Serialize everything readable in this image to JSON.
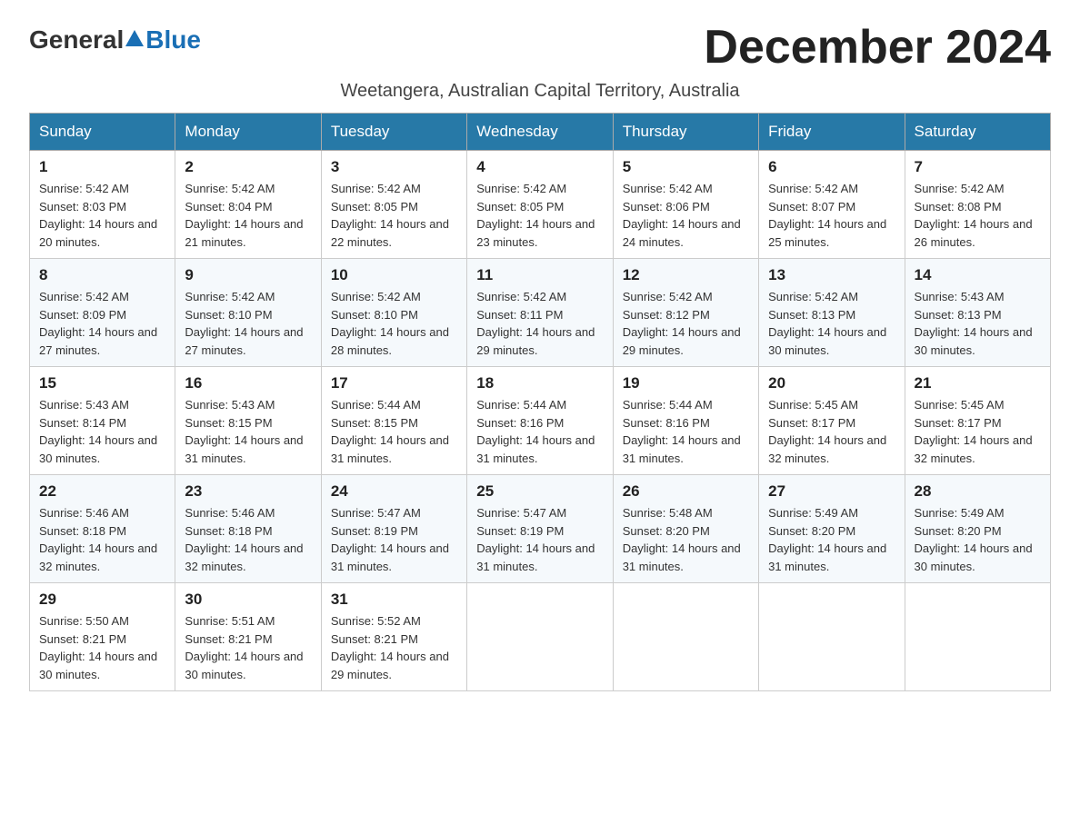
{
  "logo": {
    "general": "General",
    "blue": "Blue"
  },
  "header": {
    "month_year": "December 2024",
    "location": "Weetangera, Australian Capital Territory, Australia"
  },
  "columns": [
    "Sunday",
    "Monday",
    "Tuesday",
    "Wednesday",
    "Thursday",
    "Friday",
    "Saturday"
  ],
  "weeks": [
    [
      {
        "day": "1",
        "sunrise": "5:42 AM",
        "sunset": "8:03 PM",
        "daylight": "14 hours and 20 minutes."
      },
      {
        "day": "2",
        "sunrise": "5:42 AM",
        "sunset": "8:04 PM",
        "daylight": "14 hours and 21 minutes."
      },
      {
        "day": "3",
        "sunrise": "5:42 AM",
        "sunset": "8:05 PM",
        "daylight": "14 hours and 22 minutes."
      },
      {
        "day": "4",
        "sunrise": "5:42 AM",
        "sunset": "8:05 PM",
        "daylight": "14 hours and 23 minutes."
      },
      {
        "day": "5",
        "sunrise": "5:42 AM",
        "sunset": "8:06 PM",
        "daylight": "14 hours and 24 minutes."
      },
      {
        "day": "6",
        "sunrise": "5:42 AM",
        "sunset": "8:07 PM",
        "daylight": "14 hours and 25 minutes."
      },
      {
        "day": "7",
        "sunrise": "5:42 AM",
        "sunset": "8:08 PM",
        "daylight": "14 hours and 26 minutes."
      }
    ],
    [
      {
        "day": "8",
        "sunrise": "5:42 AM",
        "sunset": "8:09 PM",
        "daylight": "14 hours and 27 minutes."
      },
      {
        "day": "9",
        "sunrise": "5:42 AM",
        "sunset": "8:10 PM",
        "daylight": "14 hours and 27 minutes."
      },
      {
        "day": "10",
        "sunrise": "5:42 AM",
        "sunset": "8:10 PM",
        "daylight": "14 hours and 28 minutes."
      },
      {
        "day": "11",
        "sunrise": "5:42 AM",
        "sunset": "8:11 PM",
        "daylight": "14 hours and 29 minutes."
      },
      {
        "day": "12",
        "sunrise": "5:42 AM",
        "sunset": "8:12 PM",
        "daylight": "14 hours and 29 minutes."
      },
      {
        "day": "13",
        "sunrise": "5:42 AM",
        "sunset": "8:13 PM",
        "daylight": "14 hours and 30 minutes."
      },
      {
        "day": "14",
        "sunrise": "5:43 AM",
        "sunset": "8:13 PM",
        "daylight": "14 hours and 30 minutes."
      }
    ],
    [
      {
        "day": "15",
        "sunrise": "5:43 AM",
        "sunset": "8:14 PM",
        "daylight": "14 hours and 30 minutes."
      },
      {
        "day": "16",
        "sunrise": "5:43 AM",
        "sunset": "8:15 PM",
        "daylight": "14 hours and 31 minutes."
      },
      {
        "day": "17",
        "sunrise": "5:44 AM",
        "sunset": "8:15 PM",
        "daylight": "14 hours and 31 minutes."
      },
      {
        "day": "18",
        "sunrise": "5:44 AM",
        "sunset": "8:16 PM",
        "daylight": "14 hours and 31 minutes."
      },
      {
        "day": "19",
        "sunrise": "5:44 AM",
        "sunset": "8:16 PM",
        "daylight": "14 hours and 31 minutes."
      },
      {
        "day": "20",
        "sunrise": "5:45 AM",
        "sunset": "8:17 PM",
        "daylight": "14 hours and 32 minutes."
      },
      {
        "day": "21",
        "sunrise": "5:45 AM",
        "sunset": "8:17 PM",
        "daylight": "14 hours and 32 minutes."
      }
    ],
    [
      {
        "day": "22",
        "sunrise": "5:46 AM",
        "sunset": "8:18 PM",
        "daylight": "14 hours and 32 minutes."
      },
      {
        "day": "23",
        "sunrise": "5:46 AM",
        "sunset": "8:18 PM",
        "daylight": "14 hours and 32 minutes."
      },
      {
        "day": "24",
        "sunrise": "5:47 AM",
        "sunset": "8:19 PM",
        "daylight": "14 hours and 31 minutes."
      },
      {
        "day": "25",
        "sunrise": "5:47 AM",
        "sunset": "8:19 PM",
        "daylight": "14 hours and 31 minutes."
      },
      {
        "day": "26",
        "sunrise": "5:48 AM",
        "sunset": "8:20 PM",
        "daylight": "14 hours and 31 minutes."
      },
      {
        "day": "27",
        "sunrise": "5:49 AM",
        "sunset": "8:20 PM",
        "daylight": "14 hours and 31 minutes."
      },
      {
        "day": "28",
        "sunrise": "5:49 AM",
        "sunset": "8:20 PM",
        "daylight": "14 hours and 30 minutes."
      }
    ],
    [
      {
        "day": "29",
        "sunrise": "5:50 AM",
        "sunset": "8:21 PM",
        "daylight": "14 hours and 30 minutes."
      },
      {
        "day": "30",
        "sunrise": "5:51 AM",
        "sunset": "8:21 PM",
        "daylight": "14 hours and 30 minutes."
      },
      {
        "day": "31",
        "sunrise": "5:52 AM",
        "sunset": "8:21 PM",
        "daylight": "14 hours and 29 minutes."
      },
      null,
      null,
      null,
      null
    ]
  ]
}
